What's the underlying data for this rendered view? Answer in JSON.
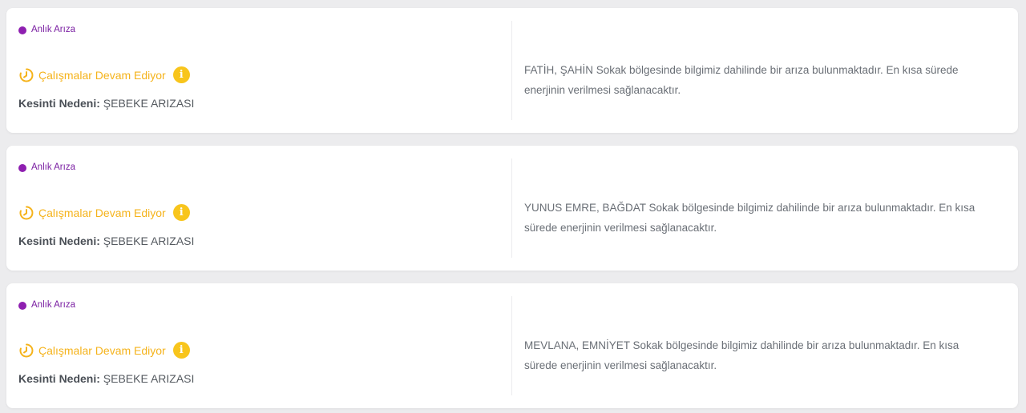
{
  "outages": [
    {
      "badge": "Anlık Arıza",
      "status": "Çalışmalar Devam Ediyor",
      "reason_label": "Kesinti Nedeni:",
      "reason_value": "ŞEBEKE ARIZASI",
      "description": "FATİH, ŞAHİN Sokak bölgesinde bilgimiz dahilinde bir arıza bulunmaktadır. En kısa sürede enerjinin verilmesi sağlanacaktır."
    },
    {
      "badge": "Anlık Arıza",
      "status": "Çalışmalar Devam Ediyor",
      "reason_label": "Kesinti Nedeni:",
      "reason_value": "ŞEBEKE ARIZASI",
      "description": "YUNUS EMRE, BAĞDAT Sokak bölgesinde bilgimiz dahilinde bir arıza bulunmaktadır. En kısa sürede enerjinin verilmesi sağlanacaktır."
    },
    {
      "badge": "Anlık Arıza",
      "status": "Çalışmalar Devam Ediyor",
      "reason_label": "Kesinti Nedeni:",
      "reason_value": "ŞEBEKE ARIZASI",
      "description": "MEVLANA, EMNİYET Sokak bölgesinde bilgimiz dahilinde bir arıza bulunmaktadır. En kısa sürede enerjinin verilmesi sağlanacaktır."
    }
  ],
  "icons": {
    "badge": "dot-icon",
    "status": "clock-icon",
    "info": "info-icon"
  },
  "colors": {
    "badge_text": "#7a1fa2",
    "badge_dot": "#8e1fb0",
    "status": "#f5b31b",
    "info_bg": "#f8c51c"
  },
  "info_glyph": "i"
}
